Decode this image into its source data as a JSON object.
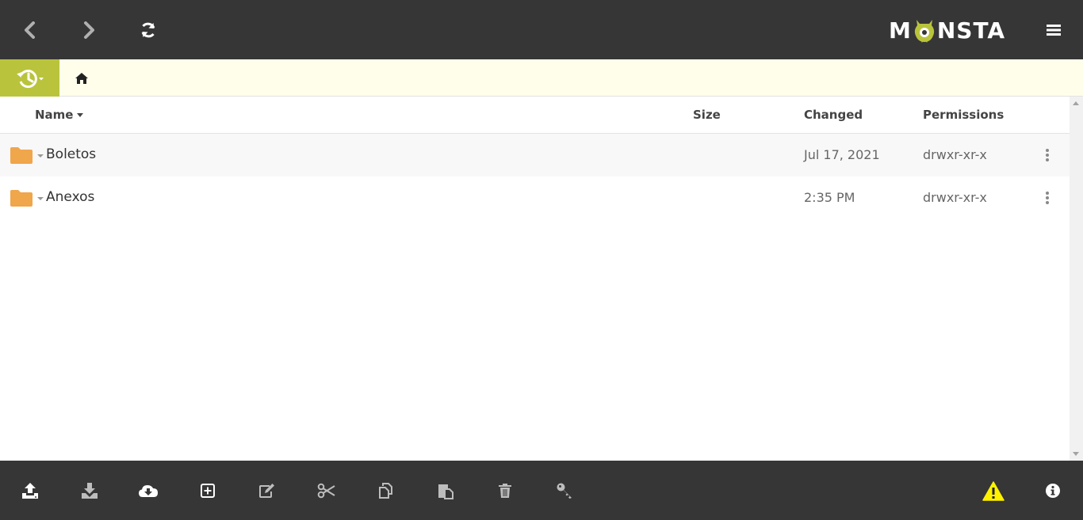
{
  "app": {
    "logo_text_left": "M",
    "logo_text_right": "NSTA",
    "colors": {
      "bar_bg": "#363636",
      "accent": "#b9c43c",
      "crumb_bg": "#fffeea",
      "folder": "#f0a64b",
      "warning": "#fff200"
    }
  },
  "topbar": {
    "back_icon": "chevron-left-icon",
    "forward_icon": "chevron-right-icon",
    "refresh_icon": "refresh-icon",
    "menu_icon": "hamburger-icon"
  },
  "breadcrumb": {
    "history_icon": "history-icon",
    "home_icon": "home-icon"
  },
  "table": {
    "columns": {
      "name": "Name",
      "size": "Size",
      "changed": "Changed",
      "permissions": "Permissions"
    },
    "rows": [
      {
        "name": "Boletos",
        "size": "",
        "changed": "Jul 17, 2021",
        "permissions": "drwxr-xr-x"
      },
      {
        "name": "Anexos",
        "size": "",
        "changed": "2:35 PM",
        "permissions": "drwxr-xr-x"
      }
    ]
  },
  "toolbar": {
    "icons": [
      "upload-icon",
      "download-icon",
      "cloud-download-icon",
      "new-item-icon",
      "edit-icon",
      "cut-icon",
      "copy-icon",
      "paste-icon",
      "trash-icon",
      "key-icon",
      "warning-icon",
      "info-icon"
    ]
  }
}
